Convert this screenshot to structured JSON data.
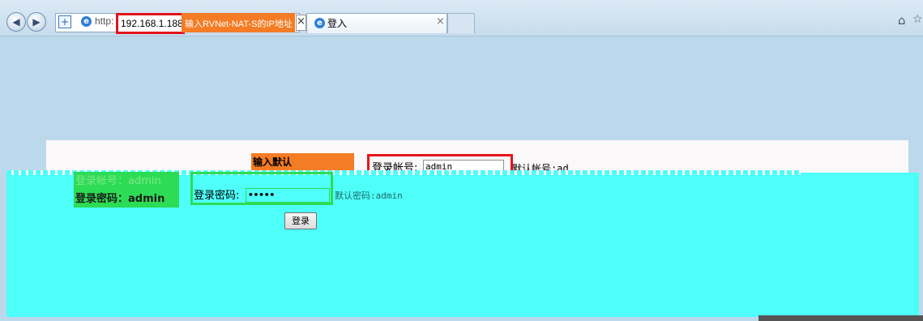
{
  "browser": {
    "url_prefix": "http:",
    "url_host": "192.168.1.188",
    "tab_title": "登入",
    "tab_close": "×",
    "callout_close": "×",
    "back_glyph": "◀",
    "forward_glyph": "▶",
    "add_glyph": "+",
    "home_glyph": "⌂",
    "star_glyph": "☆",
    "icon_names": [
      "back-arrow-icon",
      "forward-arrow-icon",
      "add-icon",
      "ie-icon",
      "home-icon",
      "star-icon"
    ]
  },
  "annotations": {
    "enter_ip": "输入RVNet-NAT-S的IP地址",
    "enter_default": "输入默认",
    "default_account_hint": "登录帐号：admin",
    "default_password_hint": "登录密码：admin",
    "sub_hint": "默认帐号"
  },
  "login": {
    "account_label": "登录帐号:",
    "account_value": "admin",
    "account_default": "默认帐号:ad",
    "password_label": "登录密码:",
    "password_value": "•••••",
    "password_default": "默认密码:admin",
    "submit_label": "登录"
  },
  "colors": {
    "highlight_red": "#e3151c",
    "note_orange": "#f47c25",
    "note_green": "#2ddc55",
    "cyan": "#4efef8",
    "page_bg": "#bcd9ec"
  }
}
